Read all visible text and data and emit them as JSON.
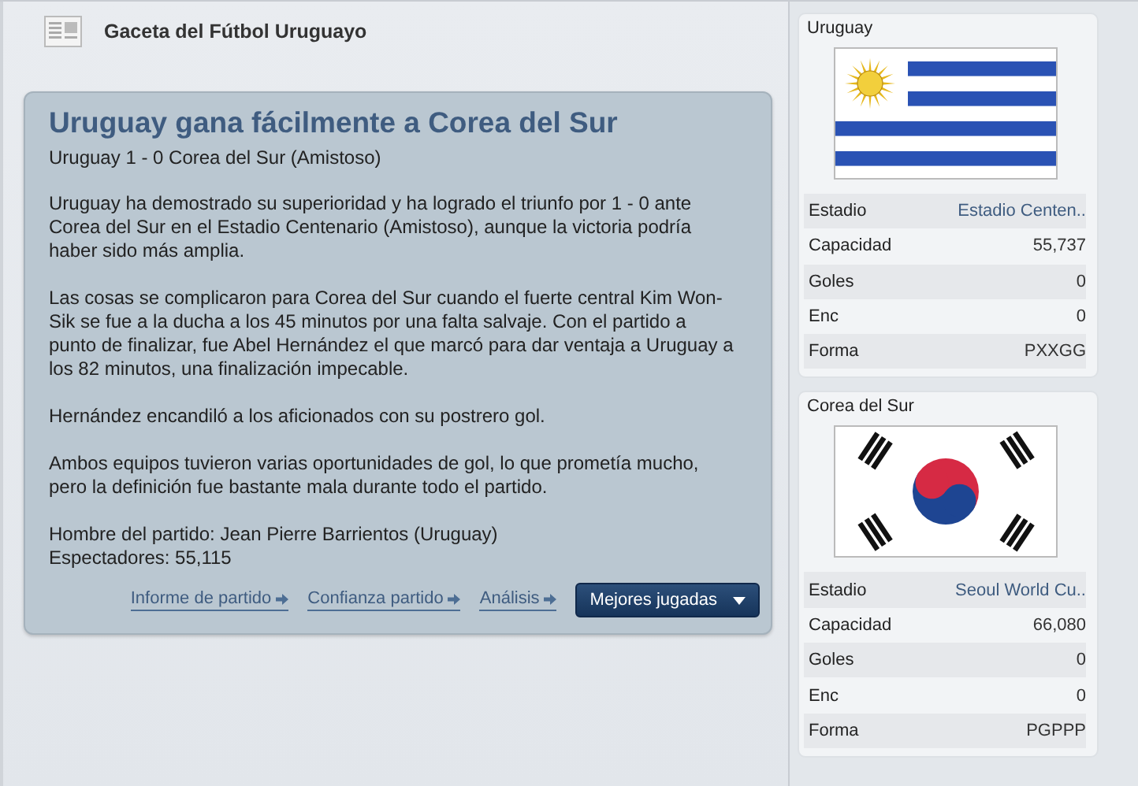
{
  "header": {
    "title": "Gaceta del Fútbol Uruguayo"
  },
  "article": {
    "headline": "Uruguay gana fácilmente a Corea del Sur",
    "subtitle": "Uruguay 1 - 0 Corea del Sur (Amistoso)",
    "paragraphs": [
      "Uruguay ha demostrado su superioridad y ha logrado el triunfo por 1 - 0 ante Corea del Sur en el Estadio Centenario (Amistoso), aunque la victoria podría haber sido más amplia.",
      "Las cosas se complicaron para Corea del Sur cuando el fuerte central Kim Won-Sik se fue a la ducha a los 45 minutos por una falta salvaje. Con el partido a punto de finalizar, fue Abel Hernández el que marcó para dar ventaja a Uruguay a los 82 minutos, una finalización impecable.",
      "Hernández encandiló a los aficionados con su postrero gol.",
      "Ambos equipos tuvieron varias oportunidades de gol, lo que prometía mucho, pero la definición fue bastante mala durante todo el partido."
    ],
    "facts": [
      "Hombre del partido: Jean Pierre Barrientos (Uruguay)",
      "Espectadores: 55,115"
    ],
    "actions": [
      {
        "kind": "link",
        "label": "Informe de partido"
      },
      {
        "kind": "link",
        "label": "Confianza partido"
      },
      {
        "kind": "link",
        "label": "Análisis"
      },
      {
        "kind": "dropdown",
        "label": "Mejores jugadas"
      }
    ]
  },
  "teams": [
    {
      "name": "Uruguay",
      "kind": "uruguay",
      "rows": [
        {
          "label": "Estadio",
          "value": "Estadio Centen..",
          "kind": "link"
        },
        {
          "label": "Capacidad",
          "value": "55,737",
          "kind": "text"
        },
        {
          "label": "Goles",
          "value": "0",
          "kind": "text"
        },
        {
          "label": "Enc",
          "value": "0",
          "kind": "text"
        },
        {
          "label": "Forma",
          "value": "PXXGG",
          "kind": "text"
        }
      ]
    },
    {
      "name": "Corea del Sur",
      "kind": "korea",
      "rows": [
        {
          "label": "Estadio",
          "value": "Seoul World Cu..",
          "kind": "link"
        },
        {
          "label": "Capacidad",
          "value": "66,080",
          "kind": "text"
        },
        {
          "label": "Goles",
          "value": "0",
          "kind": "text"
        },
        {
          "label": "Enc",
          "value": "0",
          "kind": "text"
        },
        {
          "label": "Forma",
          "value": "PGPPP",
          "kind": "text"
        }
      ]
    }
  ]
}
